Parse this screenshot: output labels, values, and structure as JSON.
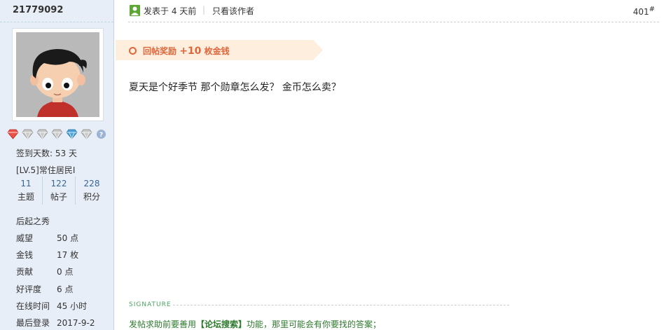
{
  "user": {
    "username": "21779092",
    "signin_days": "签到天数: 53 天",
    "level": "[LV.5]常住居民I",
    "stats": [
      {
        "num": "11",
        "label": "主题"
      },
      {
        "num": "122",
        "label": "帖子"
      },
      {
        "num": "228",
        "label": "积分"
      }
    ],
    "title": "后起之秀",
    "props": [
      {
        "key": "威望",
        "value": "50 点"
      },
      {
        "key": "金钱",
        "value": "17 枚"
      },
      {
        "key": "贡献",
        "value": "0 点"
      },
      {
        "key": "好评度",
        "value": "6 点"
      },
      {
        "key": "在线时间",
        "value": "45 小时"
      },
      {
        "key": "最后登录",
        "value": "2017-9-2"
      }
    ],
    "medal_icons": [
      "red-gem-medal-icon",
      "silver-gem-medal-icon",
      "silver-gem-medal-icon",
      "silver-gem-medal-icon",
      "blue-gem-medal-icon",
      "silver-gem-medal-icon",
      "help-icon"
    ]
  },
  "post": {
    "posted_time": "发表于 4 天前",
    "separator": "|",
    "only_author": "只看该作者",
    "floor": "401",
    "floor_mark": "#",
    "reward_label": "回帖奖励",
    "reward_amount": "+10",
    "reward_unit": "枚金钱",
    "content": "夏天是个好季节 那个勋章怎么发？ 金币怎么卖？"
  },
  "signature": {
    "label": "SIGNATURE",
    "text_before": "发帖求助前要善用",
    "highlight": "【论坛搜索】",
    "text_after": "功能，那里可能会有你要找的答案；"
  },
  "colors": {
    "sidebar_bg": "#e8eef7",
    "reward_accent": "#e0663c",
    "link_blue": "#336699",
    "signature_green": "#2c7a2c"
  }
}
